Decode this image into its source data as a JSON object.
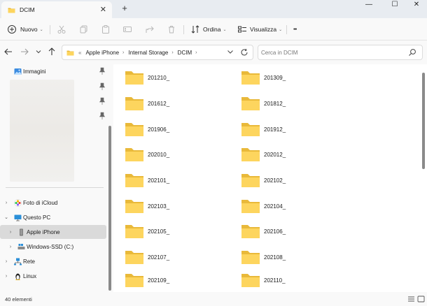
{
  "window": {
    "tab_title": "DCIM",
    "new_tab_symbol": "+",
    "close_tab_symbol": "✕",
    "minimize_symbol": "—",
    "maximize_symbol": "☐",
    "close_symbol": "✕"
  },
  "toolbar": {
    "new_label": "Nuovo",
    "sort_label": "Ordina",
    "view_label": "Visualizza",
    "more_symbol": "•••"
  },
  "address": {
    "overflow": "«",
    "crumbs": [
      "Apple iPhone",
      "Internal Storage",
      "DCIM"
    ]
  },
  "search": {
    "placeholder": "Cerca in DCIM"
  },
  "sidebar": {
    "pinned": {
      "label": "Immagini"
    },
    "items": [
      {
        "label": "Foto di iCloud"
      },
      {
        "label": "Questo PC"
      },
      {
        "label": "Apple iPhone"
      },
      {
        "label": "Windows-SSD (C:)"
      },
      {
        "label": "Rete"
      },
      {
        "label": "Linux"
      }
    ]
  },
  "folders": {
    "left": [
      "201210_",
      "201612_",
      "201906_",
      "202010_",
      "202101_",
      "202103_",
      "202105_",
      "202107_",
      "202109_"
    ],
    "right": [
      "201309_",
      "201812_",
      "201912_",
      "202012_",
      "202102_",
      "202104_",
      "202106_",
      "202108_",
      "202110_"
    ]
  },
  "status": {
    "count_text": "40 elementi"
  },
  "colors": {
    "accent": "#0067c0",
    "folder_back": "#e9b93a",
    "folder_front": "#fdd55e"
  }
}
